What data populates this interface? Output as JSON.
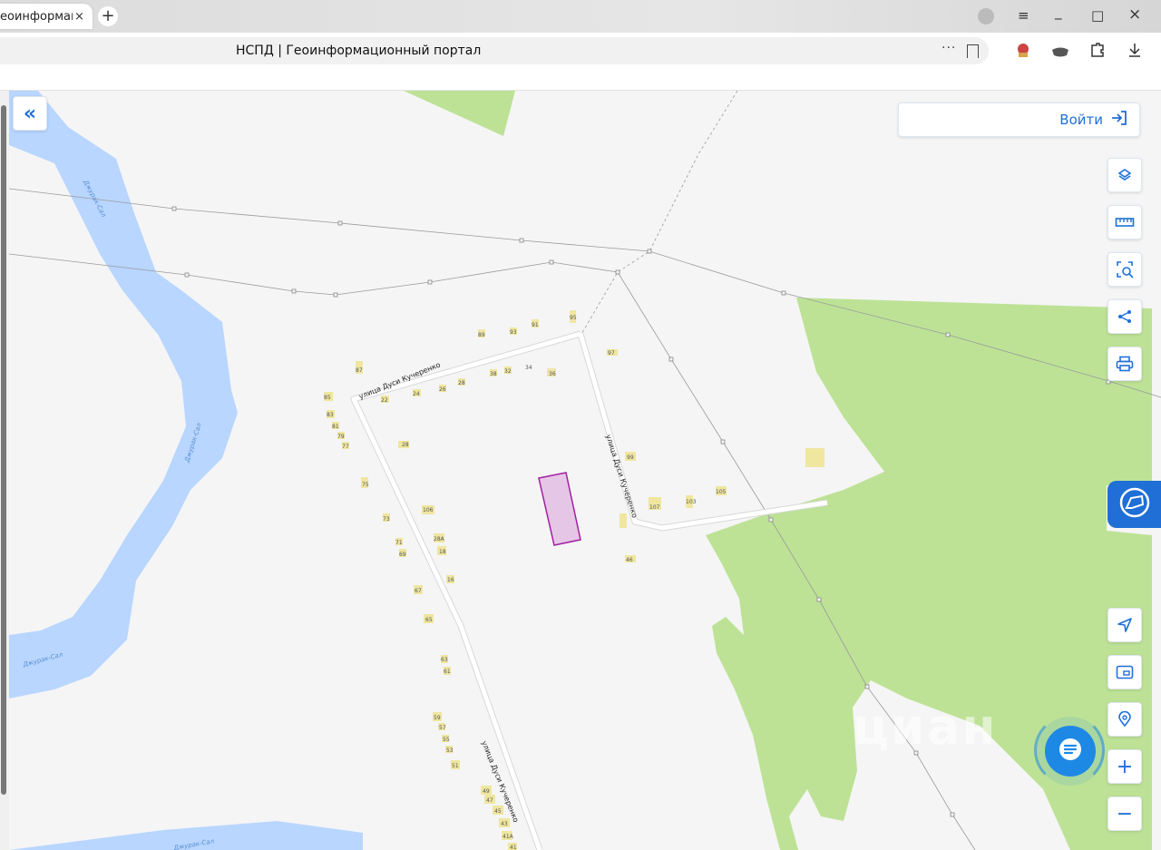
{
  "browser": {
    "tab_title": "еоинформаци",
    "tab_close": "×",
    "new_tab": "+",
    "page_title": "НСПД | Геоинформационный портал",
    "more": "···",
    "menu": "≡",
    "minimize": "_",
    "maximize": "□",
    "close": "×"
  },
  "map": {
    "login_label": "Войти",
    "collapse_label": "«",
    "zoom_in": "+",
    "zoom_out": "−",
    "watermark": "циан",
    "street_labels": [
      "улица Дуси Кучеренко",
      "улица Дуси Кучеренко",
      "улица Дуси Кучеренко"
    ],
    "river_labels": [
      "Джурак-Сал",
      "Джурак-Сал",
      "Джурак-Сал",
      "Джурак-Сал"
    ],
    "house_numbers": [
      "89",
      "93",
      "91",
      "95",
      "97",
      "87",
      "38",
      "32",
      "34",
      "36",
      "22",
      "24",
      "26",
      "28",
      "85",
      "83",
      "81",
      "79",
      "77",
      "28",
      "75",
      "99",
      "107",
      "103",
      "105",
      "106",
      "73",
      "71",
      "69",
      "28А",
      "18",
      "16",
      "67",
      "65",
      "63",
      "61",
      "59",
      "57",
      "55",
      "53",
      "51",
      "49",
      "47",
      "45",
      "43",
      "41А",
      "41",
      "46"
    ],
    "colors": {
      "water": "#b8d6ff",
      "forest": "#bde296",
      "building": "#efe6a0",
      "parcel_fill": "#e6c6e6",
      "parcel_stroke": "#a020a0",
      "accent": "#1e6fd9"
    }
  },
  "icons": {
    "layers": "layers-icon",
    "ruler": "ruler-icon",
    "select": "area-select-icon",
    "share": "share-icon",
    "print": "print-icon",
    "locate": "navigation-arrow-icon",
    "minimap": "minimap-icon",
    "search_location": "location-search-icon",
    "chat": "chat-icon"
  }
}
